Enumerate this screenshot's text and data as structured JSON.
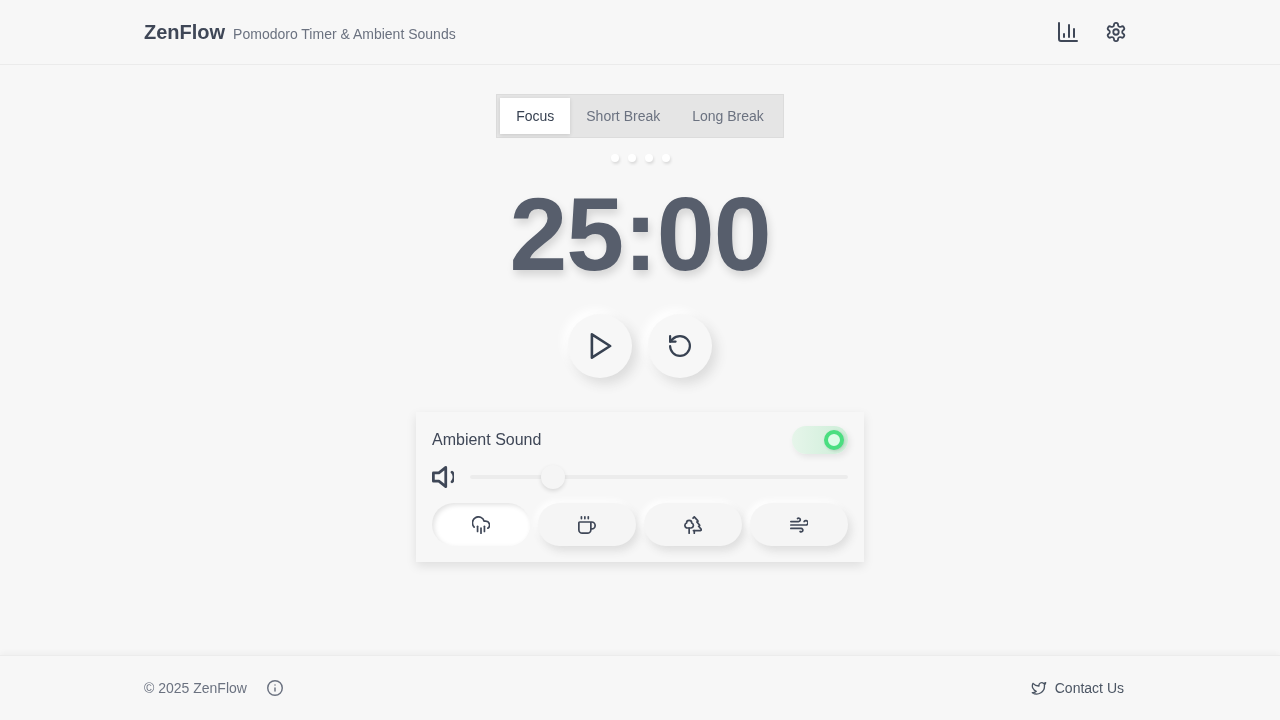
{
  "header": {
    "logo": "ZenFlow",
    "tagline": "Pomodoro Timer & Ambient Sounds"
  },
  "modes": [
    {
      "label": "Focus",
      "selected": true
    },
    {
      "label": "Short Break",
      "selected": false
    },
    {
      "label": "Long Break",
      "selected": false
    }
  ],
  "session_dots": [
    {
      "completed": false
    },
    {
      "completed": false
    },
    {
      "completed": false
    },
    {
      "completed": false
    }
  ],
  "timer": {
    "display": "25:00",
    "running": false
  },
  "ambient": {
    "title": "Ambient Sound",
    "on": true,
    "volume": {
      "level": 0.2
    },
    "sounds": [
      {
        "kind": "rain",
        "selected": true
      },
      {
        "kind": "cafe",
        "selected": false
      },
      {
        "kind": "forest",
        "selected": false
      },
      {
        "kind": "wind",
        "selected": false
      }
    ]
  },
  "footer": {
    "copyright": "© 2025 ZenFlow",
    "contact": "Contact Us"
  }
}
